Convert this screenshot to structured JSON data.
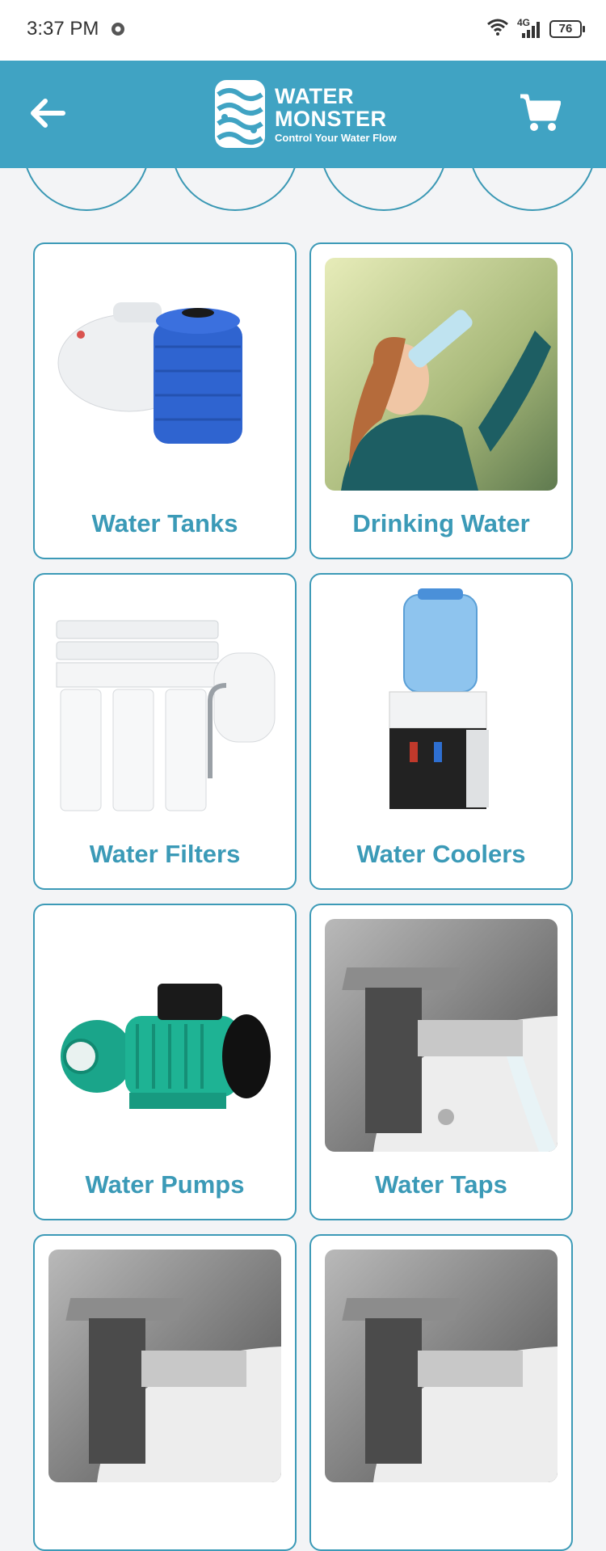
{
  "status_bar": {
    "time": "3:37 PM",
    "network": "4G",
    "battery": "76"
  },
  "header": {
    "logo_title_line1": "WATER",
    "logo_title_line2": "MONSTER",
    "logo_tagline": "Control Your Water Flow",
    "back_icon": "arrow-left-icon",
    "cart_icon": "shopping-cart-icon"
  },
  "colors": {
    "header_bg": "#40a3c3",
    "accent": "#3b9ab7",
    "page_bg": "#f3f4f6"
  },
  "categories": [
    {
      "label": "Water Tanks",
      "image": "water-tanks-image"
    },
    {
      "label": "Drinking Water",
      "image": "drinking-water-image"
    },
    {
      "label": "Water Filters",
      "image": "water-filters-image"
    },
    {
      "label": "Water Coolers",
      "image": "water-coolers-image"
    },
    {
      "label": "Water Pumps",
      "image": "water-pumps-image"
    },
    {
      "label": "Water Taps",
      "image": "water-taps-image"
    },
    {
      "label": "",
      "image": "faucet-image"
    },
    {
      "label": "",
      "image": "faucet-image"
    }
  ]
}
